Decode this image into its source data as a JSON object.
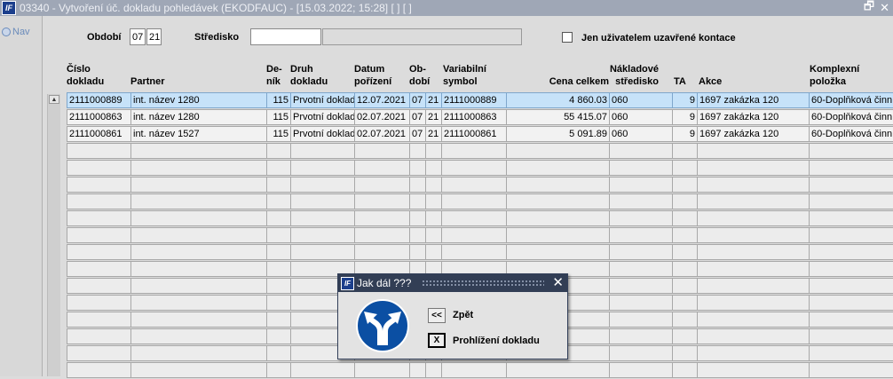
{
  "window": {
    "logo_text": "IF",
    "title": "03340 - Vytvoření úč. dokladu pohledávek (EKODFAUC) - [15.03.2022; 15:28]  [ ]  [ ]",
    "restore_glyph": "🗗",
    "close_glyph": "✕"
  },
  "leftpane": {
    "nav_label": "Nav"
  },
  "filters": {
    "obdobi_label": "Období",
    "obdobi_month": "07",
    "obdobi_year": "21",
    "stredisko_label": "Středisko",
    "stredisko_value": "",
    "checkbox_label": "Jen uživatelem uzavřené kontace"
  },
  "columns": [
    {
      "line1": "Číslo",
      "line2": "dokladu"
    },
    {
      "line1": "",
      "line2": "Partner"
    },
    {
      "line1": "De-",
      "line2": "ník"
    },
    {
      "line1": "Druh",
      "line2": "dokladu"
    },
    {
      "line1": "Datum",
      "line2": "pořízení"
    },
    {
      "line1": "Ob-",
      "line2": "dobí"
    },
    {
      "line1": "Variabilní",
      "line2": "symbol"
    },
    {
      "line1": "",
      "line2": "Cena celkem"
    },
    {
      "line1": "Nákladové",
      "line2": "středisko"
    },
    {
      "line1": "",
      "line2": "TA"
    },
    {
      "line1": "",
      "line2": "Akce"
    },
    {
      "line1": "Komplexní",
      "line2": "položka"
    }
  ],
  "rows": [
    {
      "cislo": "2111000889",
      "partner": "int. název 1280",
      "denik": "115",
      "druh": "Prvotní doklad",
      "datum": "12.07.2021",
      "obd_m": "07",
      "obd_r": "21",
      "var": "2111000889",
      "cena": "4 860.03",
      "str": "060",
      "ta": "9",
      "akce": "1697 zakázka 120",
      "kompl": "60-Doplňková činn"
    },
    {
      "cislo": "2111000863",
      "partner": "int. název 1280",
      "denik": "115",
      "druh": "Prvotní doklad",
      "datum": "02.07.2021",
      "obd_m": "07",
      "obd_r": "21",
      "var": "2111000863",
      "cena": "55 415.07",
      "str": "060",
      "ta": "9",
      "akce": "1697 zakázka 120",
      "kompl": "60-Doplňková činn"
    },
    {
      "cislo": "2111000861",
      "partner": "int. název 1527",
      "denik": "115",
      "druh": "Prvotní doklad",
      "datum": "02.07.2021",
      "obd_m": "07",
      "obd_r": "21",
      "var": "2111000861",
      "cena": "5 091.89",
      "str": "060",
      "ta": "9",
      "akce": "1697 zakázka 120",
      "kompl": "60-Doplňková činn"
    }
  ],
  "dialog": {
    "logo_text": "IF",
    "title": "Jak dál ???",
    "close_glyph": "✕",
    "back_button": "<<",
    "back_label": "Zpět",
    "browse_button": "X",
    "browse_label": "Prohlížení dokladu"
  },
  "colors": {
    "titlebar": "#9fa7b6",
    "selected_row": "#c6e2f9",
    "dialog_title": "#323e55",
    "sign_blue": "#0b4fa3"
  },
  "icons": {
    "scroll_up": "▲",
    "dialog_sign": "fork-arrows-icon"
  }
}
